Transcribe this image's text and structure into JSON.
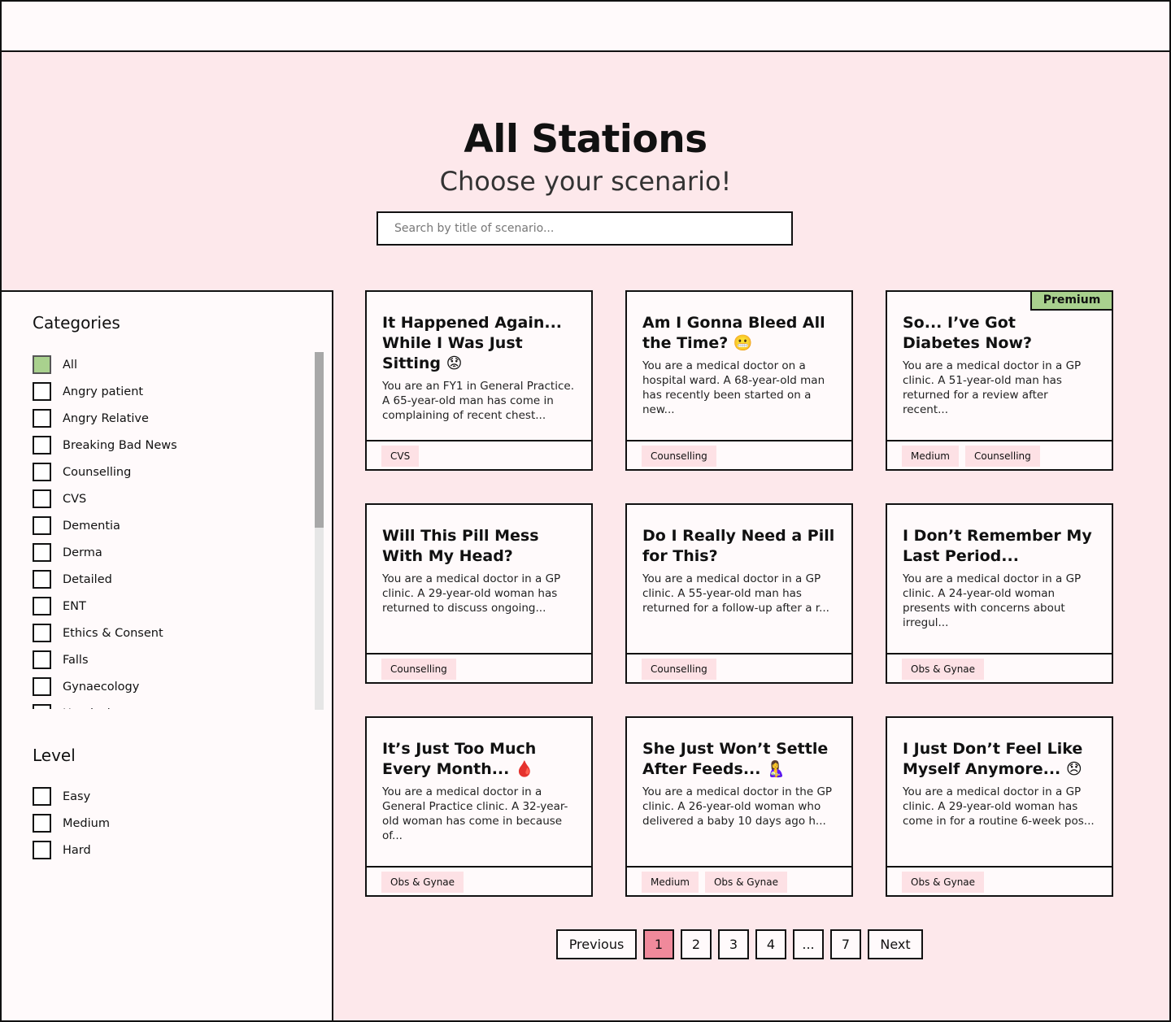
{
  "hero": {
    "title": "All Stations",
    "subtitle": "Choose your scenario!",
    "search_placeholder": "Search by title of scenario..."
  },
  "sidebar": {
    "categories_heading": "Categories",
    "categories": [
      {
        "label": "All",
        "checked": true
      },
      {
        "label": "Angry patient",
        "checked": false
      },
      {
        "label": "Angry Relative",
        "checked": false
      },
      {
        "label": "Breaking Bad News",
        "checked": false
      },
      {
        "label": "Counselling",
        "checked": false
      },
      {
        "label": "CVS",
        "checked": false
      },
      {
        "label": "Dementia",
        "checked": false
      },
      {
        "label": "Derma",
        "checked": false
      },
      {
        "label": "Detailed",
        "checked": false
      },
      {
        "label": "ENT",
        "checked": false
      },
      {
        "label": "Ethics & Consent",
        "checked": false
      },
      {
        "label": "Falls",
        "checked": false
      },
      {
        "label": "Gynaecology",
        "checked": false
      },
      {
        "label": "Headache",
        "checked": false
      }
    ],
    "level_heading": "Level",
    "levels": [
      {
        "label": "Easy",
        "checked": false
      },
      {
        "label": "Medium",
        "checked": false
      },
      {
        "label": "Hard",
        "checked": false
      }
    ]
  },
  "cards": [
    {
      "title": "It Happened Again... While I Was Just Sitting 😟",
      "desc": "You are an FY1 in General Practice. A 65-year-old man has come in complaining of recent chest...",
      "tags": [
        "CVS"
      ],
      "premium": false
    },
    {
      "title": "Am I Gonna Bleed All the Time? 😬",
      "desc": "You are a medical doctor on a hospital ward. A 68-year-old man has recently been started on a new...",
      "tags": [
        "Counselling"
      ],
      "premium": false
    },
    {
      "title": "So... I’ve Got Diabetes Now?",
      "desc": "You are a medical doctor in a GP clinic. A 51-year-old man has returned for a review after recent...",
      "tags": [
        "Medium",
        "Counselling"
      ],
      "premium": true
    },
    {
      "title": "Will This Pill Mess With My Head?",
      "desc": "You are a medical doctor in a GP clinic. A 29-year-old woman has returned to discuss ongoing...",
      "tags": [
        "Counselling"
      ],
      "premium": false
    },
    {
      "title": "Do I Really Need a Pill for This?",
      "desc": "You are a medical doctor in a GP clinic. A 55-year-old man has returned for a follow-up after a r...",
      "tags": [
        "Counselling"
      ],
      "premium": false
    },
    {
      "title": "I Don’t Remember My Last Period...",
      "desc": "You are a medical doctor in a GP clinic. A 24-year-old woman presents with concerns about irregul...",
      "tags": [
        "Obs & Gynae"
      ],
      "premium": false
    },
    {
      "title": "It’s Just Too Much Every Month... 🩸",
      "desc": "You are a medical doctor in a General Practice clinic. A 32-year-old woman has come in because of...",
      "tags": [
        "Obs & Gynae"
      ],
      "premium": false
    },
    {
      "title": "She Just Won’t Settle After Feeds... 🤱",
      "desc": "You are a medical doctor in the GP clinic. A 26-year-old woman who delivered a baby 10 days ago h...",
      "tags": [
        "Medium",
        "Obs & Gynae"
      ],
      "premium": false
    },
    {
      "title": "I Just Don’t Feel Like Myself Anymore... 😞",
      "desc": "You are a medical doctor in a GP clinic. A 29-year-old woman has come in for a routine 6-week pos...",
      "tags": [
        "Obs & Gynae"
      ],
      "premium": false
    }
  ],
  "premium_label": "Premium",
  "pagination": {
    "previous": "Previous",
    "next": "Next",
    "pages": [
      "1",
      "2",
      "3",
      "4",
      "...",
      "7"
    ],
    "current": "1"
  },
  "colors": {
    "background": "#fde8eb",
    "checked_box": "#a9d18e",
    "premium_badge": "#a9d18e",
    "active_page": "#f0899b",
    "tag_bg": "#fde1e5"
  }
}
